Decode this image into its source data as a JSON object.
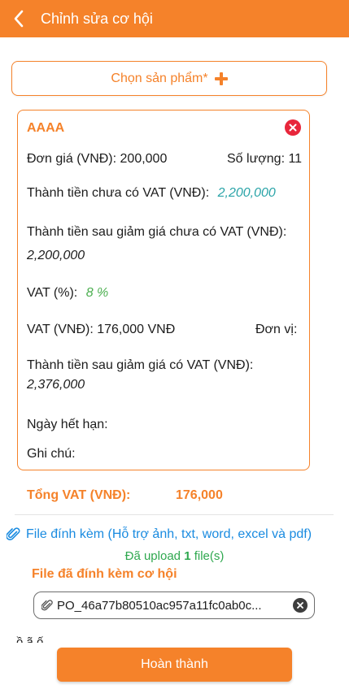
{
  "header": {
    "title": "Chỉnh sửa cơ hội"
  },
  "select_product": {
    "label": "Chọn sản phẩm*"
  },
  "product": {
    "name": "AAAA",
    "unit_price_label": "Đơn giá (VNĐ): 200,000",
    "quantity_label": "Số lượng: 11",
    "subtotal_label": "Thành tiền chưa có VAT (VNĐ):",
    "subtotal_value": "2,200,000",
    "discounted_label": "Thành tiền sau giảm giá chưa có VAT (VNĐ):",
    "discounted_value": "2,200,000",
    "vat_percent_label": "VAT (%):",
    "vat_percent_value": "8 %",
    "vat_amount_label": "VAT (VNĐ): 176,000 VNĐ",
    "unit_label": "Đơn vị:",
    "total_with_vat_label": "Thành tiền sau giảm giá có VAT (VNĐ):",
    "total_with_vat_value": "2,376,000",
    "expiry_label": "Ngày hết hạn:",
    "note_label": "Ghi chú:"
  },
  "summary": {
    "total_vat_label": "Tổng VAT (VNĐ):",
    "total_vat_value": "176,000"
  },
  "attachments": {
    "link_label": "File đính kèm (Hỗ trợ ảnh, txt, word, excel và pdf)",
    "uploaded_prefix": "Đã upload",
    "uploaded_count": "1",
    "uploaded_suffix": "file(s)",
    "attached_title": "File đã đính kèm cơ hội",
    "file_name": "PO_46a77b80510ac957a11fc0ab0c...",
    "cut_off_text": "ồ     ã  ố"
  },
  "footer": {
    "done_label": "Hoàn thành"
  },
  "colors": {
    "accent": "#f5822a",
    "teal_value": "#2aa4a8",
    "green_value": "#4caf50",
    "link_blue": "#1a8be0",
    "danger": "#e8263b"
  }
}
